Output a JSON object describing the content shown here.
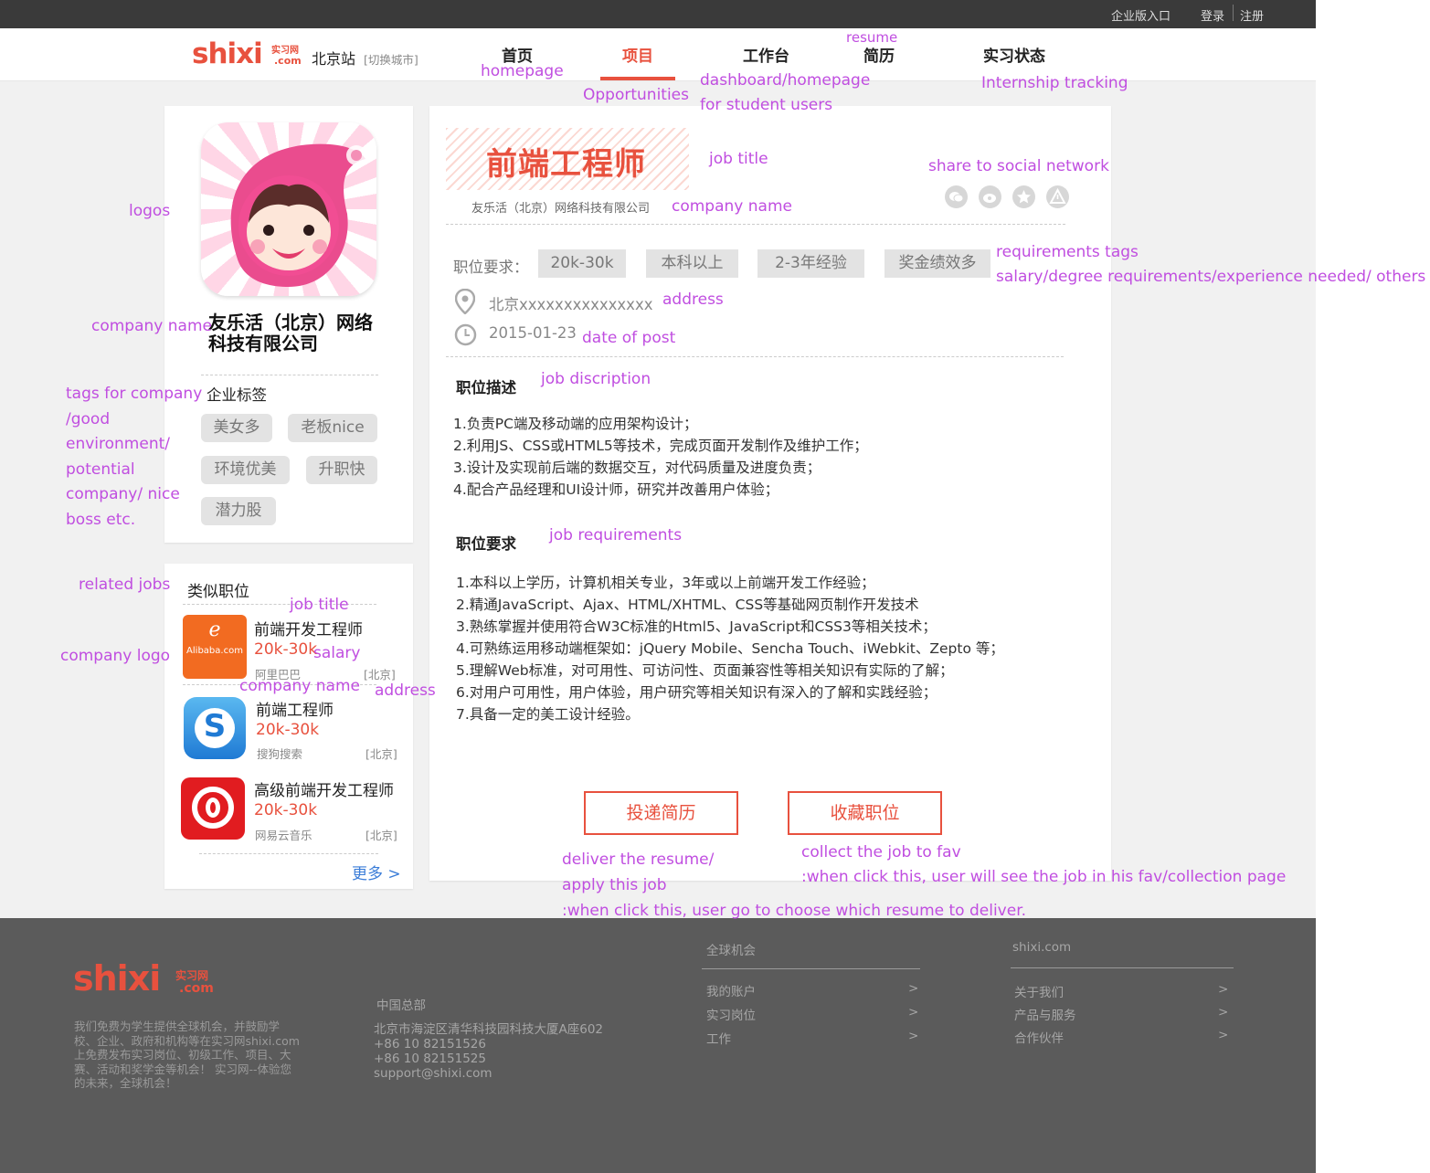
{
  "topbar": {
    "enterprise": "企业版入口",
    "login": "登录",
    "register": "注册"
  },
  "nav": {
    "logo": "shixi",
    "logo_cn": "实习网",
    "logo_com": ".com",
    "city": "北京站",
    "switch_city": "[切换城市]",
    "items": [
      "首页",
      "项目",
      "工作台",
      "简历",
      "实习状态"
    ]
  },
  "company": {
    "name": "友乐活（北京）网络科技有限公司",
    "tags_title": "企业标签",
    "tags": [
      "美女多",
      "老板nice",
      "环境优美",
      "升职快",
      "潜力股"
    ]
  },
  "similar": {
    "title": "类似职位",
    "more": "更多 >",
    "jobs": [
      {
        "title": "前端开发工程师",
        "salary": "20k-30k",
        "company": "阿里巴巴",
        "location": "[北京]",
        "logo_text": "Alibaba.com"
      },
      {
        "title": "前端工程师",
        "salary": "20k-30k",
        "company": "搜狗搜索",
        "location": "[北京]"
      },
      {
        "title": "高级前端开发工程师",
        "salary": "20k-30k",
        "company": "网易云音乐",
        "location": "[北京]"
      }
    ]
  },
  "job": {
    "title": "前端工程师",
    "company": "友乐活（北京）网络科技有限公司",
    "req_label": "职位要求：",
    "req_tags": [
      "20k-30k",
      "本科以上",
      "2-3年经验",
      "奖金绩效多"
    ],
    "address": "北京xxxxxxxxxxxxxxx",
    "date": "2015-01-23",
    "desc_title": "职位描述",
    "desc": [
      "1.负责PC端及移动端的应用架构设计；",
      "2.利用JS、CSS或HTML5等技术，完成页面开发制作及维护工作；",
      "3.设计及实现前后端的数据交互，对代码质量及进度负责；",
      "4.配合产品经理和UI设计师，研究并改善用户体验；"
    ],
    "req_title": "职位要求",
    "reqs": [
      "1.本科以上学历，计算机相关专业，3年或以上前端开发工作经验；",
      "2.精通JavaScript、Ajax、HTML/XHTML、CSS等基础网页制作开发技术",
      "3.熟练掌握并使用符合W3C标准的Html5、JavaScript和CSS3等相关技术；",
      "4.可熟练运用移动端框架如：jQuery Mobile、Sencha Touch、iWebkit、Zepto 等；",
      "5.理解Web标准，对可用性、可访问性、页面兼容性等相关知识有实际的了解；",
      "6.对用户可用性，用户体验，用户研究等相关知识有深入的了解和实践经验；",
      "7.具备一定的美工设计经验。"
    ],
    "apply_btn": "投递简历",
    "fav_btn": "收藏职位"
  },
  "annotations": {
    "homepage": "homepage",
    "opportunities": "Opportunities",
    "dashboard1": "dashboard/homepage",
    "dashboard2": "for student users",
    "resume": "resume",
    "tracking": "Internship tracking",
    "job_title": "job title",
    "share": "share to social network",
    "company_name": "company name",
    "req_tags1": "requirements tags",
    "req_tags2": "salary/degree requirements/experience needed/ others",
    "address": "address",
    "date": "date of post",
    "job_desc": "job discription",
    "job_req": "job requirements",
    "logos": "logos",
    "left_company_name": "company name",
    "tags_company": [
      "tags for company",
      "/good",
      "environment/",
      "potential",
      "company/ nice",
      "boss etc."
    ],
    "related_jobs": "related jobs",
    "rel_job_title": "job title",
    "rel_salary": "salary",
    "rel_company_logo": "company logo",
    "rel_company_name": "company name",
    "rel_address": "address",
    "deliver": [
      "deliver the resume/",
      "apply this job",
      ":when click this, user go to choose which resume to deliver."
    ],
    "collect": [
      "collect the job to fav",
      ":when click this, user will see the job in his fav/collection page"
    ]
  },
  "footer": {
    "logo": "shixi",
    "logo_cn": "实习网",
    "logo_com": ".com",
    "about": [
      "我们免费为学生提供全球机会，并鼓励学",
      "校、企业、政府和机构等在实习网shixi.com",
      "上免费发布实习岗位、初级工作、项目、大",
      "赛、活动和奖学金等机会！ 实习网--体验您",
      "的未来，全球机会！"
    ],
    "hq_title": "中国总部",
    "hq": [
      "北京市海淀区清华科技园科技大厦A座602",
      "+86 10 82151526",
      "+86 10 82151525",
      "support@shixi.com"
    ],
    "col1_title": "全球机会",
    "col1": [
      "我的账户",
      "实习岗位",
      "工作"
    ],
    "col2_title": "shixi.com",
    "col2": [
      "关于我们",
      "产品与服务",
      "合作伙伴"
    ],
    "arrow": ">"
  },
  "colors": {
    "accent": "#e8513e",
    "annotation": "#c04ee0",
    "link_blue": "#3b7dd8"
  }
}
